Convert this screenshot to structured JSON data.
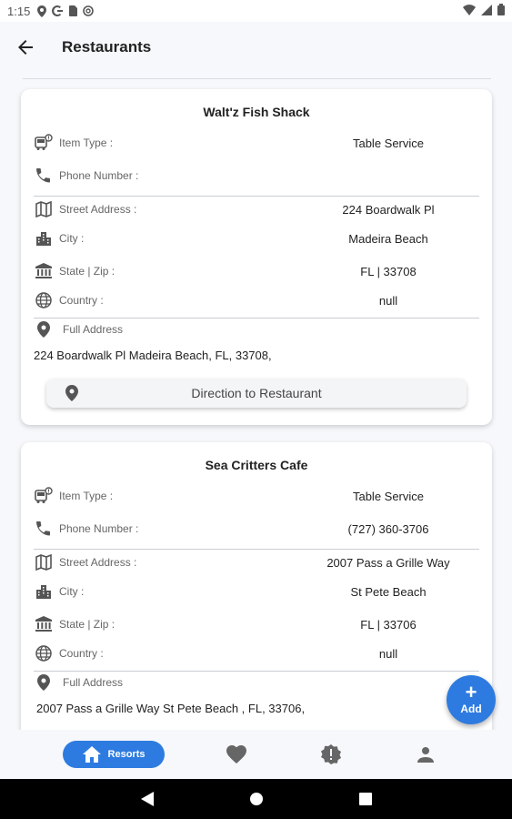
{
  "status_bar": {
    "time": "1:15",
    "left_icons": [
      "location-icon",
      "google-icon",
      "sim-card-icon",
      "at-sign-icon"
    ],
    "right_icons": [
      "wifi-icon",
      "signal-icon",
      "battery-icon"
    ]
  },
  "header": {
    "title": "Restaurants",
    "back_icon": "arrow-back-icon"
  },
  "labels": {
    "item_type": "Item Type :",
    "phone": "Phone Number :",
    "street": "Street Address :",
    "city": "City :",
    "state_zip": "State | Zip :",
    "country": "Country :",
    "full_address": "Full Address"
  },
  "restaurants": [
    {
      "name": "Walt'z Fish Shack",
      "item_type": "Table Service",
      "phone": "",
      "street": "224 Boardwalk Pl",
      "city": "Madeira Beach",
      "state_zip": "FL | 33708",
      "country": "null",
      "full_address": "224 Boardwalk Pl Madeira Beach, FL, 33708,",
      "direction_label": "Direction to Restaurant"
    },
    {
      "name": "Sea Critters Cafe",
      "item_type": "Table Service",
      "phone": "(727) 360-3706",
      "street": "2007 Pass a Grille Way",
      "city": "St Pete Beach",
      "state_zip": "FL | 33706",
      "country": "null",
      "full_address": "2007 Pass a Grille Way St Pete Beach , FL, 33706,"
    }
  ],
  "fab": {
    "plus": "+",
    "label": "Add"
  },
  "bottom_nav": {
    "items": [
      {
        "label": "Resorts",
        "icon": "home-icon",
        "active": true
      },
      {
        "label": "",
        "icon": "heart-icon",
        "active": false
      },
      {
        "label": "",
        "icon": "alert-badge-icon",
        "active": false
      },
      {
        "label": "",
        "icon": "person-icon",
        "active": false
      }
    ]
  },
  "colors": {
    "accent": "#2d7be0",
    "background": "#f6f8fb",
    "card": "#ffffff"
  }
}
